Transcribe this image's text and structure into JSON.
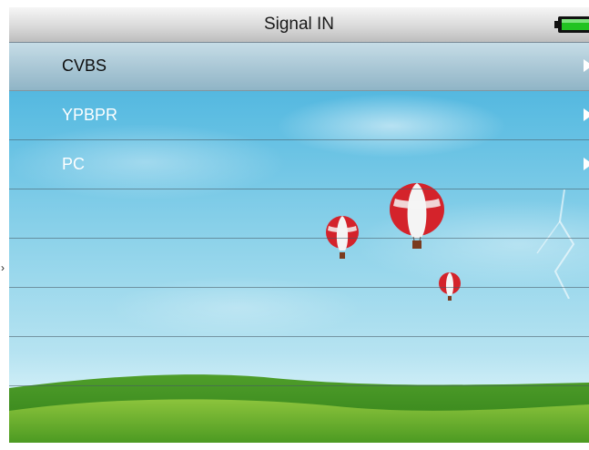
{
  "header": {
    "title": "Signal IN",
    "battery_icon": "battery-icon"
  },
  "menu": {
    "items": [
      {
        "label": "CVBS",
        "selected": true
      },
      {
        "label": "YPBPR",
        "selected": false
      },
      {
        "label": "PC",
        "selected": false
      },
      {
        "label": "",
        "selected": false
      },
      {
        "label": "",
        "selected": false
      },
      {
        "label": "",
        "selected": false
      },
      {
        "label": "",
        "selected": false
      }
    ]
  },
  "colors": {
    "sky": "#5dbde2",
    "titlebar": "#dadada",
    "battery_fill": "#22c322",
    "balloon_red": "#d4232b"
  }
}
